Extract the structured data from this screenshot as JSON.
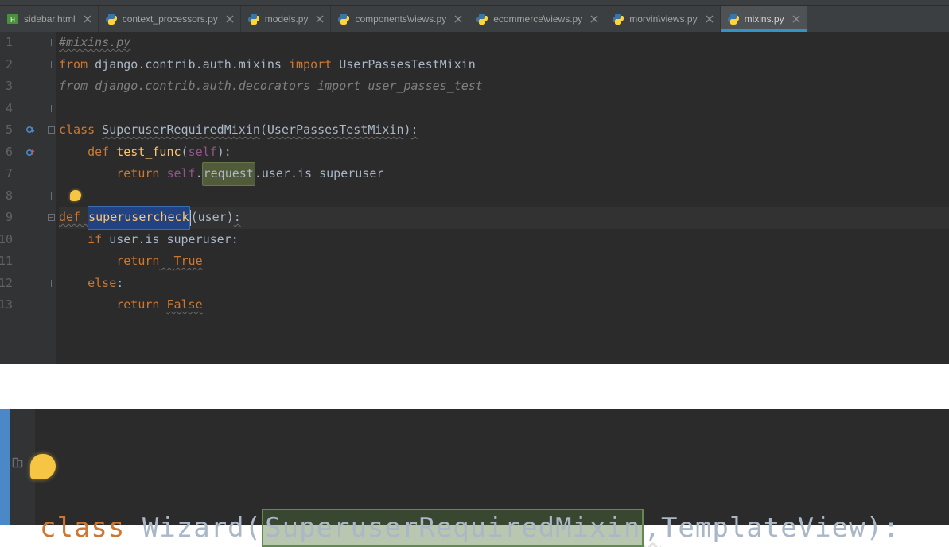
{
  "tabs": [
    {
      "label": "sidebar.html",
      "kind": "html",
      "active": false
    },
    {
      "label": "context_processors.py",
      "kind": "py",
      "active": false
    },
    {
      "label": "models.py",
      "kind": "py",
      "active": false
    },
    {
      "label": "components\\views.py",
      "kind": "py",
      "active": false
    },
    {
      "label": "ecommerce\\views.py",
      "kind": "py",
      "active": false
    },
    {
      "label": "morvin\\views.py",
      "kind": "py",
      "active": false
    },
    {
      "label": "mixins.py",
      "kind": "py",
      "active": true
    }
  ],
  "editor": {
    "selected_word": "superusercheck",
    "highlighted_word": "request",
    "caret_line": 9,
    "intention_on_line": 8,
    "lines": [
      {
        "n": 1,
        "tokens": [
          {
            "t": "#mixins.py",
            "c": "com wavy"
          }
        ]
      },
      {
        "n": 2,
        "tokens": [
          {
            "t": "from ",
            "c": "kw"
          },
          {
            "t": "django.contrib.auth.mixins ",
            "c": ""
          },
          {
            "t": "import ",
            "c": "kw"
          },
          {
            "t": "UserPassesTestMixin",
            "c": ""
          }
        ]
      },
      {
        "n": 3,
        "tokens": [
          {
            "t": "from ",
            "c": "kw com"
          },
          {
            "t": "django.contrib.auth.decorators ",
            "c": "com"
          },
          {
            "t": "import ",
            "c": "kw com"
          },
          {
            "t": "user_passes_test",
            "c": "com"
          }
        ]
      },
      {
        "n": 4,
        "tokens": []
      },
      {
        "n": 5,
        "mark": "override-down",
        "tokens": [
          {
            "t": "class ",
            "c": "kw"
          },
          {
            "t": "SuperuserRequiredMixin",
            "c": "wavy"
          },
          {
            "t": "(",
            "c": ""
          },
          {
            "t": "UserPassesTestMixin",
            "c": "wavy"
          },
          {
            "t": ")",
            "c": ""
          },
          {
            "t": ":",
            "c": "wavy"
          }
        ]
      },
      {
        "n": 6,
        "mark": "override-up",
        "tokens": [
          {
            "t": "    ",
            "c": ""
          },
          {
            "t": "def ",
            "c": "kw"
          },
          {
            "t": "test_func",
            "c": "fn"
          },
          {
            "t": "(",
            "c": ""
          },
          {
            "t": "self",
            "c": "builtin"
          },
          {
            "t": "):",
            "c": ""
          }
        ]
      },
      {
        "n": 7,
        "tokens": [
          {
            "t": "        ",
            "c": ""
          },
          {
            "t": "return ",
            "c": "kw"
          },
          {
            "t": "self",
            "c": "builtin"
          },
          {
            "t": ".",
            "c": ""
          },
          {
            "t": "request",
            "c": "hlbox"
          },
          {
            "t": ".user.is_superuser",
            "c": ""
          }
        ]
      },
      {
        "n": 8,
        "bulb": true,
        "tokens": []
      },
      {
        "n": 9,
        "current": true,
        "tokens": [
          {
            "t": "def ",
            "c": "kw wavy"
          },
          {
            "t": "superusercheck",
            "c": "fn selword"
          },
          {
            "t": "(user)",
            "c": ""
          },
          {
            "t": ":",
            "c": "wavy"
          }
        ]
      },
      {
        "n": 10,
        "tokens": [
          {
            "t": "    ",
            "c": ""
          },
          {
            "t": "if ",
            "c": "kw"
          },
          {
            "t": "user.is_superuser:",
            "c": ""
          }
        ]
      },
      {
        "n": 11,
        "tokens": [
          {
            "t": "        ",
            "c": ""
          },
          {
            "t": "return",
            "c": "kw"
          },
          {
            "t": "  ",
            "c": "wavy"
          },
          {
            "t": "True",
            "c": "kw wavy"
          }
        ]
      },
      {
        "n": 12,
        "tokens": [
          {
            "t": "    ",
            "c": ""
          },
          {
            "t": "else",
            "c": "kw"
          },
          {
            "t": ":",
            "c": ""
          }
        ]
      },
      {
        "n": 13,
        "tokens": [
          {
            "t": "        ",
            "c": ""
          },
          {
            "t": "return ",
            "c": "kw"
          },
          {
            "t": "False",
            "c": "kw wavy"
          }
        ]
      }
    ]
  },
  "bottom": {
    "tokens": [
      {
        "t": "class ",
        "c": "kw"
      },
      {
        "t": "Wizard(",
        "c": ""
      },
      {
        "t": "SuperuserRequiredMixin",
        "c": "hlbox2"
      },
      {
        "t": ",",
        "c": "wavy-o"
      },
      {
        "t": "TemplateView):",
        "c": ""
      }
    ]
  },
  "colors": {
    "keyword": "#cc7832",
    "function": "#ffc66d",
    "builtin": "#94558d",
    "comment": "#808080",
    "bg": "#2b2b2b",
    "gutter": "#313335",
    "tab_active_underline": "#3592c4"
  }
}
